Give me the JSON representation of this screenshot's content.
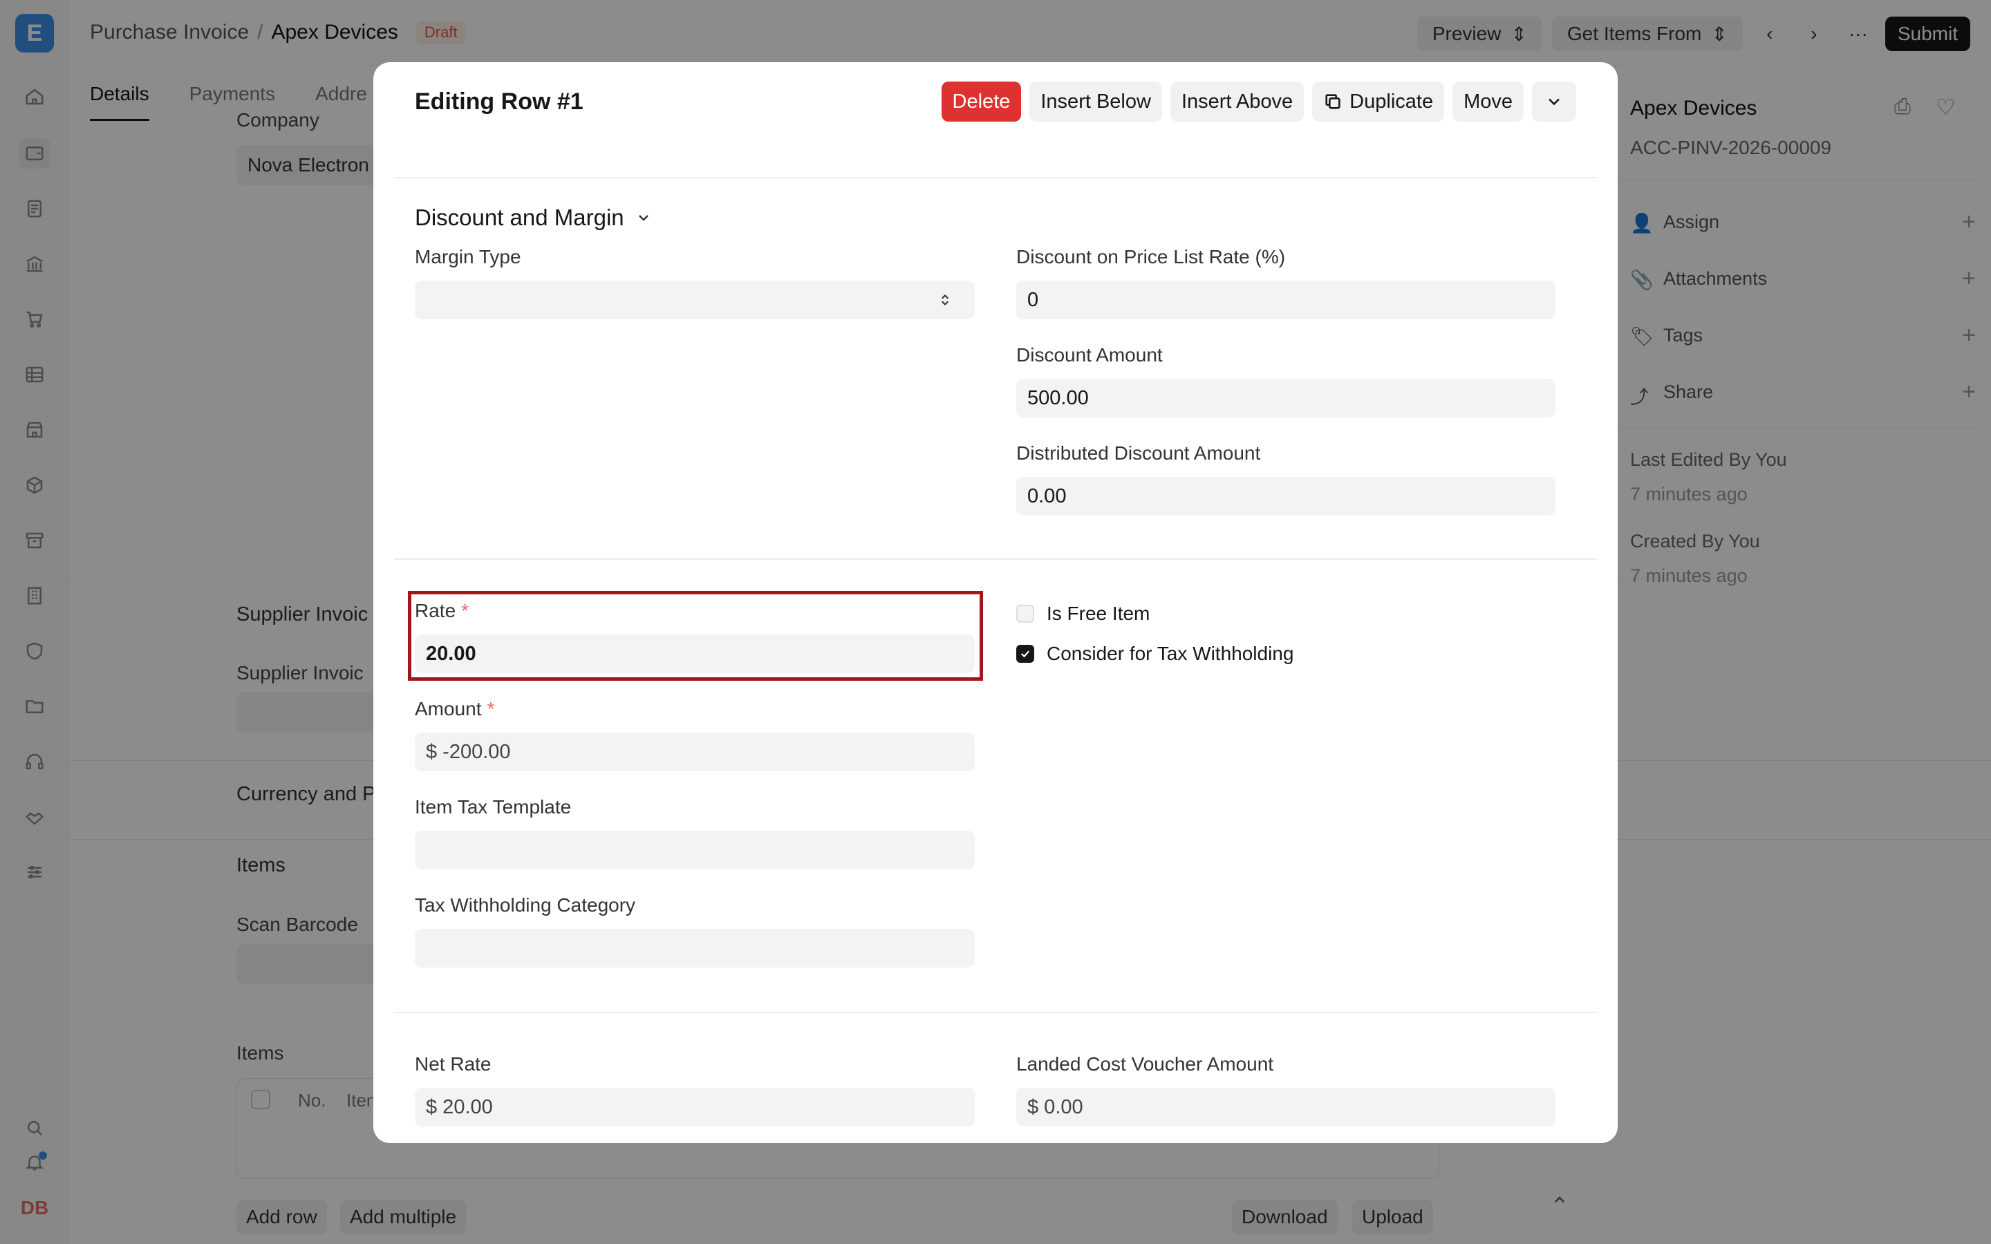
{
  "app": {
    "logo_letter": "E",
    "avatar_initials": "DB"
  },
  "breadcrumb": {
    "parent": "Purchase Invoice",
    "separator": "/",
    "current": "Apex Devices",
    "status": "Draft"
  },
  "topbar": {
    "preview": "Preview",
    "get_items": "Get Items From",
    "submit": "Submit"
  },
  "tabs": [
    "Details",
    "Payments",
    "Addre"
  ],
  "background_form": {
    "company_label": "Company",
    "company_value": "Nova Electron",
    "supplier_invoice_section": "Supplier Invoic",
    "supplier_invoice_label": "Supplier Invoic",
    "currency_section": "Currency and P",
    "items_section": "Items",
    "scan_barcode": "Scan Barcode",
    "items_label": "Items",
    "col_no": "No.",
    "col_item": "Iten",
    "add_row": "Add row",
    "add_multiple": "Add multiple",
    "download": "Download",
    "upload": "Upload"
  },
  "right_panel": {
    "title": "Apex Devices",
    "doc_id": "ACC-PINV-2026-00009",
    "assign": "Assign",
    "attachments": "Attachments",
    "tags": "Tags",
    "share": "Share",
    "last_edited": "Last Edited By You",
    "last_edited_time": "7 minutes ago",
    "created": "Created By You",
    "created_time": "7 minutes ago"
  },
  "modal": {
    "title": "Editing Row #1",
    "actions": {
      "delete": "Delete",
      "insert_below": "Insert Below",
      "insert_above": "Insert Above",
      "duplicate": "Duplicate",
      "move": "Move"
    },
    "section_title": "Discount and Margin",
    "margin_type": {
      "label": "Margin Type",
      "value": ""
    },
    "discount_pct": {
      "label": "Discount on Price List Rate (%)",
      "value": "0"
    },
    "discount_amount": {
      "label": "Discount Amount",
      "value": "500.00"
    },
    "distributed_discount": {
      "label": "Distributed Discount Amount",
      "value": "0.00"
    },
    "rate": {
      "label": "Rate",
      "required": "*",
      "value": "20.00"
    },
    "amount": {
      "label": "Amount",
      "required": "*",
      "value": "$ -200.00"
    },
    "item_tax_template": {
      "label": "Item Tax Template",
      "value": ""
    },
    "tax_withholding_category": {
      "label": "Tax Withholding Category",
      "value": ""
    },
    "is_free_item": {
      "label": "Is Free Item",
      "checked": false
    },
    "consider_tax": {
      "label": "Consider for Tax Withholding",
      "checked": true
    },
    "net_rate": {
      "label": "Net Rate",
      "value": "$ 20.00"
    },
    "landed_cost": {
      "label": "Landed Cost Voucher Amount",
      "value": "$ 0.00"
    }
  },
  "colors": {
    "danger": "#e03131",
    "highlight_border": "#a3161a",
    "brand": "#3d8fe6"
  }
}
